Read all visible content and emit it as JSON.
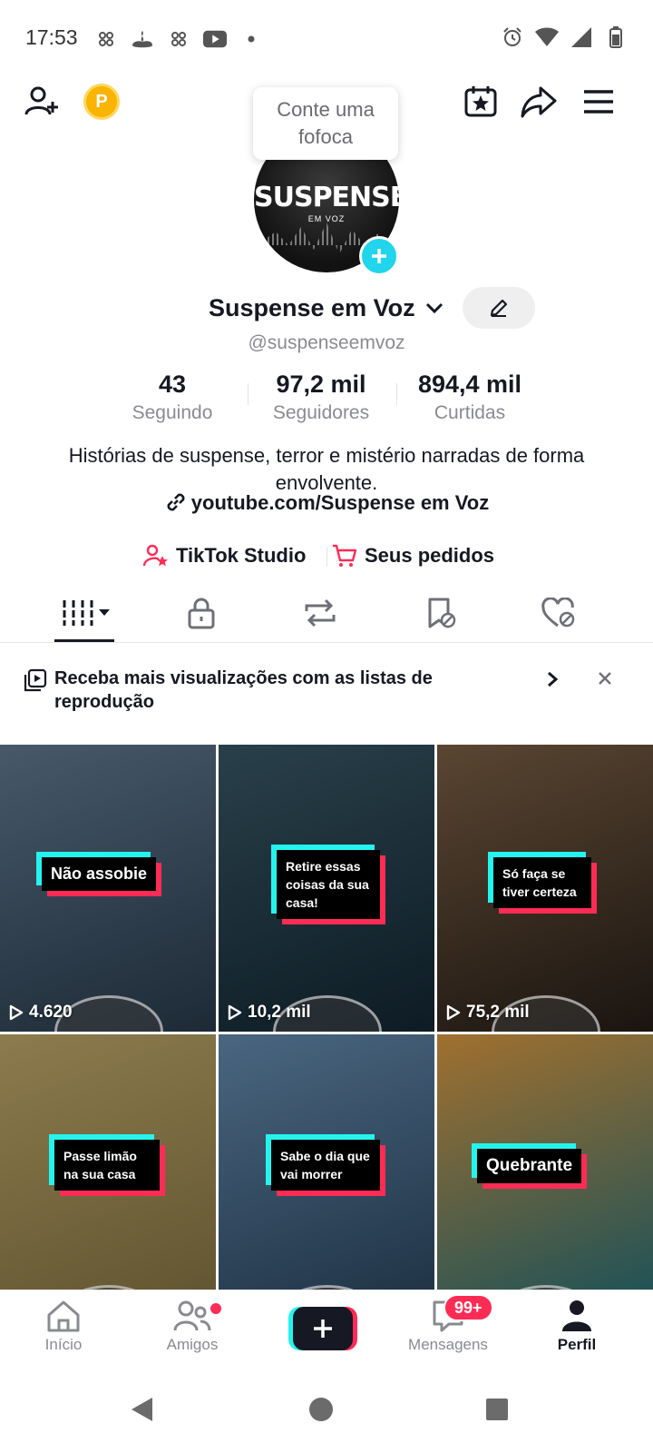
{
  "status_bar": {
    "time": "17:53",
    "left_icons": [
      "notification-icon",
      "santander-icon",
      "notification-icon",
      "youtube-icon",
      "dot-icon"
    ],
    "right_icons": [
      "alarm-icon",
      "wifi-icon",
      "signal-icon",
      "battery-icon"
    ]
  },
  "header": {
    "coin_label": "P",
    "tooltip_line1": "Conte uma",
    "tooltip_line2": "fofoca"
  },
  "profile": {
    "avatar_text": "SUSPENSE",
    "avatar_subtext": "EM VOZ",
    "display_name": "Suspense em Voz",
    "handle": "@suspenseemvoz",
    "stats": [
      {
        "value": "43",
        "label": "Seguindo"
      },
      {
        "value": "97,2 mil",
        "label": "Seguidores"
      },
      {
        "value": "894,4 mil",
        "label": "Curtidas"
      }
    ],
    "bio": "Histórias de suspense, terror e mistério narradas de forma envolvente.",
    "link": "youtube.com/Suspense em Voz",
    "shortcuts": [
      {
        "label": "TikTok Studio",
        "icon": "person-star-icon"
      },
      {
        "label": "Seus pedidos",
        "icon": "cart-icon"
      }
    ]
  },
  "tabs": [
    {
      "name": "videos",
      "icon": "grid-icon",
      "active": true
    },
    {
      "name": "private",
      "icon": "lock-icon"
    },
    {
      "name": "reposts",
      "icon": "repost-icon"
    },
    {
      "name": "favorites",
      "icon": "bookmark-icon"
    },
    {
      "name": "liked",
      "icon": "heart-hidden-icon"
    }
  ],
  "banner": {
    "text": "Receba mais visualizações com as listas de reprodução"
  },
  "videos": [
    {
      "caption": "Não assobie",
      "views": "4.620",
      "colors": [
        "#1d2a36",
        "#47596a"
      ]
    },
    {
      "caption": "Retire essas coisas da sua casa!",
      "views": "10,2 mil",
      "colors": [
        "#0d1b24",
        "#29404a"
      ]
    },
    {
      "caption": "Só faça se tiver certeza",
      "views": "75,2 mil",
      "colors": [
        "#1a1410",
        "#5a4632"
      ]
    },
    {
      "caption": "Passe limão na sua casa",
      "views": "",
      "colors": [
        "#5f5330",
        "#8c7b4d"
      ]
    },
    {
      "caption": "Sabe o dia que vai morrer",
      "views": "",
      "colors": [
        "#1d3042",
        "#4a6680"
      ]
    },
    {
      "caption": "Quebrante",
      "views": "",
      "colors": [
        "#16505a",
        "#a0702f"
      ]
    }
  ],
  "bottom_nav": {
    "items": [
      {
        "label": "Início",
        "icon": "home-icon"
      },
      {
        "label": "Amigos",
        "icon": "friends-icon"
      },
      {
        "label": "",
        "icon": "plus-icon"
      },
      {
        "label": "Mensagens",
        "icon": "message-icon"
      },
      {
        "label": "Perfil",
        "icon": "profile-icon"
      }
    ],
    "messages_badge": "99+"
  },
  "colors": {
    "accent_cyan": "#25f4ee",
    "accent_red": "#fe2c55",
    "text_primary": "#161823",
    "text_secondary": "#8a8b91"
  }
}
